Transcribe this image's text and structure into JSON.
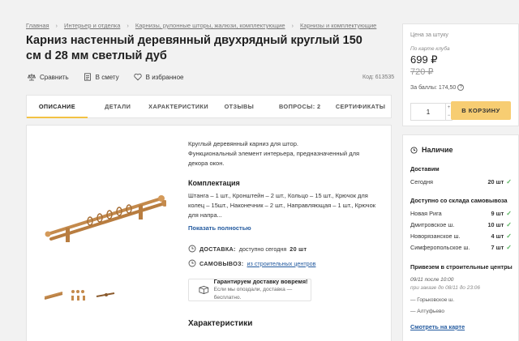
{
  "breadcrumbs": [
    "Главная",
    "Интерьер и отделка",
    "Карнизы, рулонные шторы, жалюзи, комплектующие",
    "Карнизы и комплектующие"
  ],
  "product": {
    "title": "Карниз настенный деревянный двухрядный круглый 150 см d 28 мм светлый дуб",
    "code": "Код: 613535"
  },
  "actions": {
    "compare": "Сравнить",
    "estimate": "В смету",
    "favorite": "В избранное"
  },
  "tabs": [
    "ОПИСАНИЕ",
    "ДЕТАЛИ",
    "ХАРАКТЕРИСТИКИ",
    "ОТЗЫВЫ",
    "ВОПРОСЫ: 2",
    "СЕРТИФИКАТЫ"
  ],
  "description": {
    "line1": "Круглый деревянный карниз для штор.",
    "line2": "Функциональный элемент интерьера, предназначенный для декора окон.",
    "kit_heading": "Комплектация",
    "kit_text": "Штанга – 1 шт., Кронштейн – 2 шт., Кольцо – 15 шт., Крючок для колец – 15шт., Наконечник – 2 шт., Направляющая – 1 шт., Крючок для напра...",
    "show_all": "Показать полностью"
  },
  "delivery": {
    "label": "ДОСТАВКА:",
    "text": "доступно сегодня",
    "qty": "20 шт",
    "pickup_label": "САМОВЫВОЗ:",
    "pickup_text": "из строительных центров"
  },
  "guarantee": {
    "title": "Гарантируем доставку вовремя!",
    "sub": "Если мы опоздали, доставка — бесплатно."
  },
  "characteristics_heading": "Характеристики",
  "price": {
    "label": "Цена за штуку",
    "club_label": "По карте клуба",
    "club_price": "699 ₽",
    "old_price": "720 ₽",
    "bonus": "За баллы: 174,50",
    "qty": "1",
    "cart_button": "В КОРЗИНУ"
  },
  "availability": {
    "heading": "Наличие",
    "delivery_section": "Доставим",
    "today_label": "Сегодня",
    "today_qty": "20 шт",
    "pickup_section": "Доступно со склада самовывоза",
    "stores": [
      {
        "name": "Новая Рига",
        "qty": "9 шт"
      },
      {
        "name": "Дмитровское ш.",
        "qty": "10 шт"
      },
      {
        "name": "Новорязанское ш.",
        "qty": "4 шт"
      },
      {
        "name": "Симферопольское ш.",
        "qty": "7 шт"
      }
    ],
    "centers_section": "Привезем в строительные центры",
    "centers_date": "09/11 после 10:00",
    "centers_note": "при заказе до 08/11 до 23:06",
    "center1": "— Горьковское ш.",
    "center2": "— Алтуфьево",
    "map_link": "Смотреть на карте"
  },
  "colors": {
    "accent": "#f3c244",
    "cart": "#f7cd72",
    "link": "#235a9f",
    "ok": "#55b25c"
  }
}
